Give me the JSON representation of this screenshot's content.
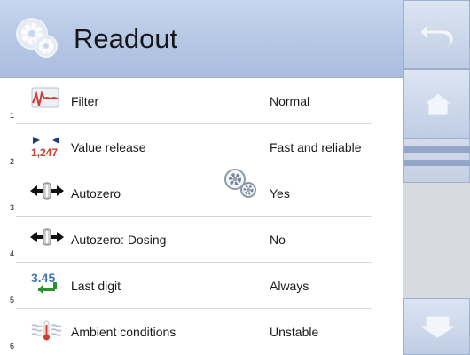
{
  "header": {
    "title": "Readout",
    "icon": "gears-icon"
  },
  "rows": [
    {
      "num": "1",
      "icon": "filter-wave-icon",
      "label": "Filter",
      "value": "Normal"
    },
    {
      "num": "2",
      "icon": "value-release-icon",
      "icon_text": "1,247",
      "label": "Value release",
      "value": "Fast and reliable"
    },
    {
      "num": "3",
      "icon": "autozero-icon",
      "label": "Autozero",
      "value": "Yes"
    },
    {
      "num": "4",
      "icon": "autozero-dosing-icon",
      "label": "Autozero: Dosing",
      "value": "No"
    },
    {
      "num": "5",
      "icon": "last-digit-icon",
      "icon_text": "3.45",
      "label": "Last digit",
      "value": "Always"
    },
    {
      "num": "6",
      "icon": "ambient-conditions-icon",
      "label": "Ambient conditions",
      "value": "Unstable"
    }
  ],
  "sidebar": {
    "back": "undo-arrow-icon",
    "home": "home-icon",
    "scroll": "scrollbar-thumb",
    "down": "down-arrow-icon"
  },
  "center_icon": "gears-icon",
  "colors": {
    "header_bg": "#b8c9e6",
    "sidebar_bg": "#cfd5dc",
    "button_border": "#9fb0cd",
    "accent_red": "#d33b2f",
    "accent_blue": "#3d74b8",
    "accent_green": "#2e8f37"
  }
}
